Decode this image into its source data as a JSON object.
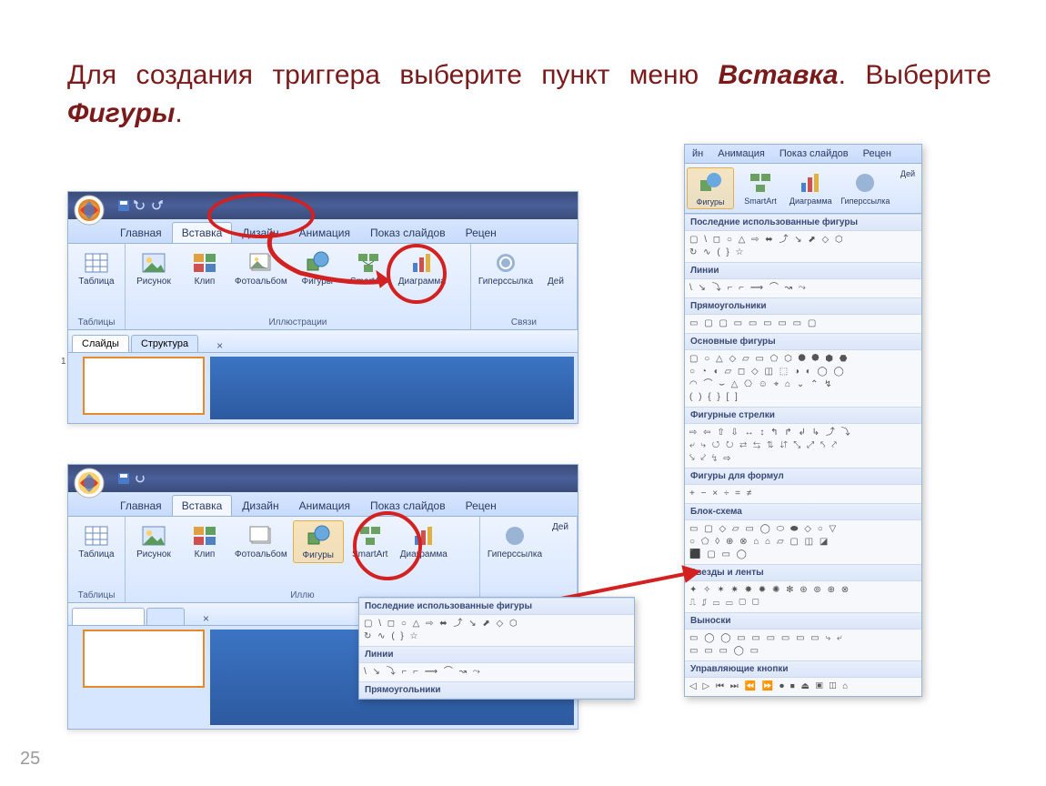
{
  "instruction": {
    "part1": "Для создания триггера выберите пункт меню ",
    "em1": "Вставка",
    "part2": ". Выберите ",
    "em2": "Фигуры",
    "part3": "."
  },
  "page_number": "25",
  "tabs": {
    "home": "Главная",
    "insert": "Вставка",
    "design": "Дизайн",
    "anim": "Анимация",
    "slideshow": "Показ слайдов",
    "review": "Рецен"
  },
  "ribbon": {
    "table": "Таблица",
    "picture": "Рисунок",
    "clip": "Клип",
    "album": "Фотоальбом",
    "shapes": "Фигуры",
    "smartart": "SmartArt",
    "chart": "Диаграмма",
    "hyperlink": "Гиперссылка",
    "action": "Дей",
    "group_tables": "Таблицы",
    "group_illustr": "Иллюстрации",
    "group_links": "Связи",
    "group_illustr_short": "Иллю"
  },
  "lower": {
    "slides": "Слайды",
    "outline": "Структура",
    "slidenum": "1"
  },
  "right_header": {
    "t1": "йн",
    "t2": "Анимация",
    "t3": "Показ слайдов",
    "t4": "Рецен",
    "btn_shapes": "Фигуры",
    "btn_smartart": "SmartArt",
    "btn_chart": "Диаграмма",
    "btn_hyper": "Гиперссылка",
    "btn_act": "Дей"
  },
  "shape_sections": {
    "recent": "Последние использованные фигуры",
    "lines": "Линии",
    "rects": "Прямоугольники",
    "basic": "Основные фигуры",
    "arrows": "Фигурные стрелки",
    "formula": "Фигуры для формул",
    "flowchart": "Блок-схема",
    "stars": "Звезды и ленты",
    "callouts": "Выноски",
    "actions": "Управляющие кнопки"
  },
  "shape_glyphs": {
    "recent": "▢ \\ ◻ ○ △ ⇨ ⬌ ⤴ ↘ ⬈ ◇ ⬡\n↻ ∿ ( } ☆",
    "lines": "\\ ↘ ⤵ ⌐ ⌐ ⟿ ⌒ ↝ ⤳",
    "rects": "▭ ▢ ▢ ▭ ▭ ▭ ▭ ▭ ▢",
    "basic": "▢ ○ △ ◇ ▱ ▭ ⬠ ⬡ ⯃ ⯄ ⬢ ⬣\n○ ◔ ◖ ▱ ◻ ◇ ◫ ⬚ ◑ ◐ ◯ ◯\n◠ ⌒ ⌣ △ ⎔ ☺ ⌖ ⌂ ⌄ ⌃ ↯\n( ) { } [ ]",
    "arrows": "⇨ ⇦ ⇧ ⇩ ↔ ↕ ↰ ↱ ↲ ↳ ⤴ ⤵\n⤶ ⤷ ↺ ↻ ⇄ ⇆ ⇅ ⇵ ⤡ ⤢ ⤣ ⤤\n⤥ ⤦ ↯ ⇨",
    "formula": "+ − × ÷ = ≠",
    "flowchart": "▭ ▢ ◇ ▱ ▭ ◯ ⬭ ⬬ ◇ ○ ▽\n○ ⬠ ◊ ⊕ ⊗ ⌂ ⌂ ▱ ▢ ◫ ◪\n⬛ ▢ ▭ ◯",
    "stars": "✦ ✧ ✶ ✷ ✸ ✹ ✺ ✻ ⊛ ⊚ ⊕ ⊗\n⎍ ⎎ ▭ ▭ ▢ ▢",
    "callouts": "▭ ◯ ◯ ▭ ▭ ▭ ▭ ▭ ▭ ⤷ ⤶\n▭ ▭ ▭ ◯ ▭",
    "actions": "◁ ▷ ⏮ ⏭ ⏪ ⏩ ⏺ ⏹ ⏏ ▣ ◫ ⌂"
  },
  "colors": {
    "annotation_red": "#d32020",
    "instruction_text": "#7a1a1a"
  }
}
